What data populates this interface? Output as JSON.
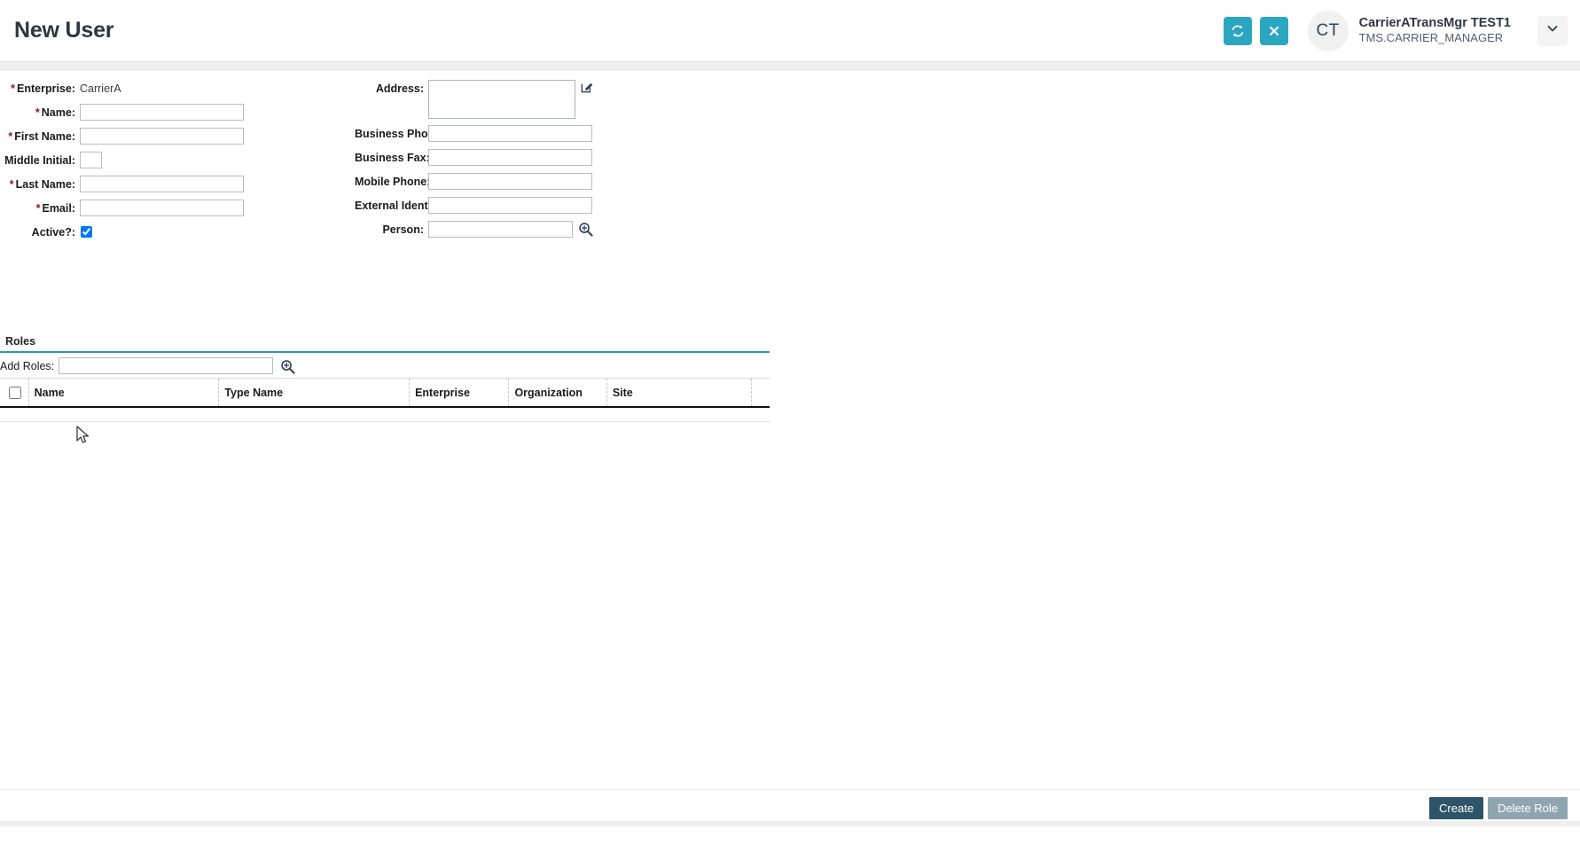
{
  "header": {
    "title": "New User",
    "refresh_icon": "refresh-icon",
    "close_icon": "close-icon",
    "avatar_initials": "CT",
    "user_name": "CarrierATransMgr TEST1",
    "user_role": "TMS.CARRIER_MANAGER",
    "chevron_icon": "chevron-down-icon",
    "accent_color": "#2ba6c0"
  },
  "form": {
    "left": {
      "enterprise_label": "Enterprise:",
      "enterprise_value": "CarrierA",
      "name_label": "Name:",
      "name_value": "",
      "first_name_label": "First Name:",
      "first_name_value": "",
      "middle_initial_label": "Middle Initial:",
      "middle_initial_value": "",
      "last_name_label": "Last Name:",
      "last_name_value": "",
      "email_label": "Email:",
      "email_value": "",
      "active_label": "Active?:",
      "active_checked": true
    },
    "right": {
      "address_label": "Address:",
      "address_value": "",
      "address_edit_icon": "edit-icon",
      "business_phone_label": "Business Phone:",
      "business_phone_value": "",
      "business_fax_label": "Business Fax:",
      "business_fax_value": "",
      "mobile_phone_label": "Mobile Phone:",
      "mobile_phone_value": "",
      "external_identity_label": "External Identity:",
      "external_identity_value": "",
      "person_label": "Person:",
      "person_value": "",
      "person_search_icon": "search-zoom-icon"
    },
    "required_marker": "*",
    "required_color": "#8b1a1a"
  },
  "roles": {
    "section_title": "Roles",
    "underline_color": "#2a9ab5",
    "add_roles_label": "Add Roles:",
    "add_roles_value": "",
    "add_roles_search_icon": "search-zoom-icon",
    "columns": [
      "Name",
      "Type Name",
      "Enterprise",
      "Organization",
      "Site"
    ],
    "rows": []
  },
  "footer": {
    "create_label": "Create",
    "delete_role_label": "Delete Role",
    "create_color": "#2d5468",
    "delete_color": "#8fa5b0"
  }
}
